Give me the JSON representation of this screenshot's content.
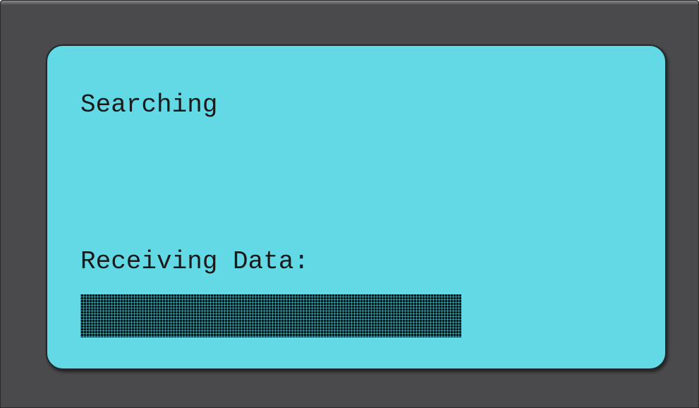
{
  "screen": {
    "status_text": "Searching",
    "progress_label": "Receiving Data:",
    "progress": 1.0,
    "colors": {
      "bezel": "#4a4a4d",
      "lcd_background": "#63d9e6",
      "text": "#1a1a1a"
    }
  }
}
